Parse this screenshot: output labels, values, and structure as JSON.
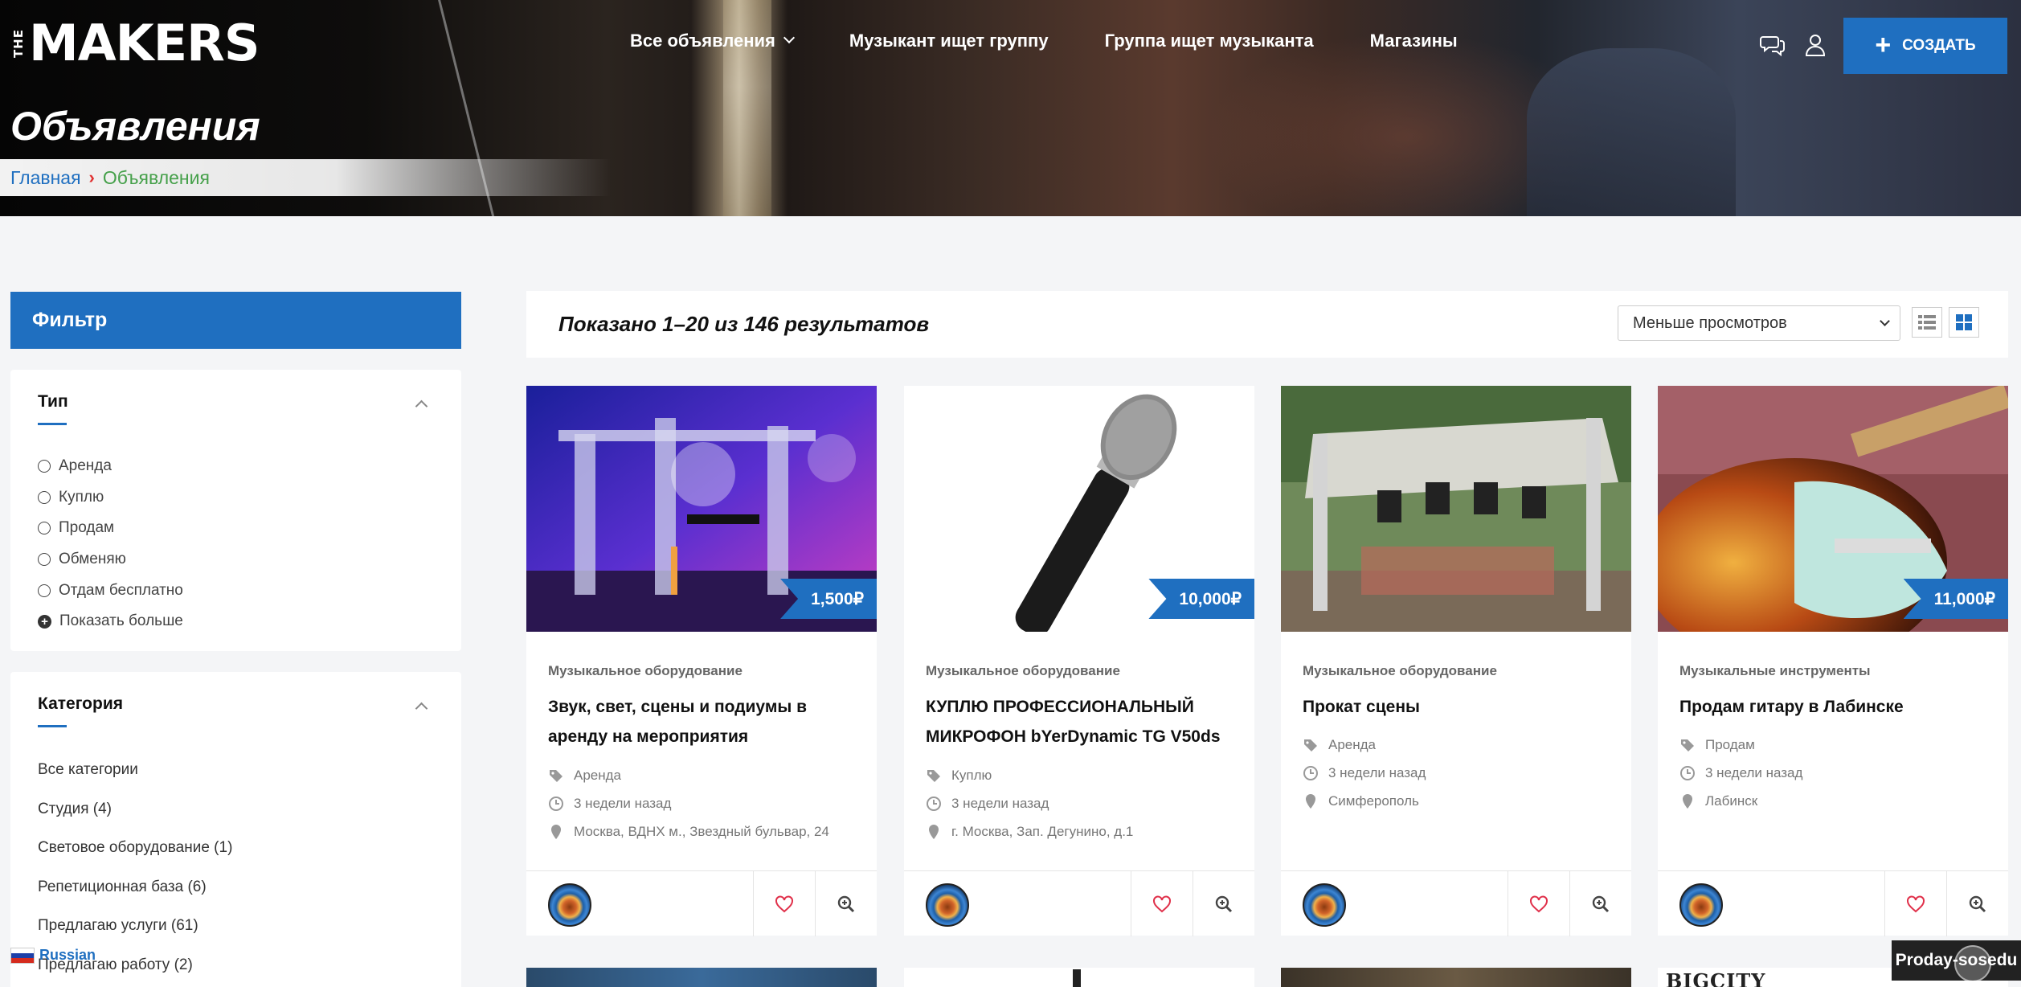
{
  "header": {
    "logo_small": "THE",
    "logo_main": "MAKERS",
    "nav": [
      {
        "label": "Все объявления",
        "has_dropdown": true
      },
      {
        "label": "Музыкант ищет группу"
      },
      {
        "label": "Группа ищет музыканта"
      },
      {
        "label": "Магазины"
      }
    ],
    "icons": [
      "chat-icon",
      "user-icon"
    ],
    "create_label": "СОЗДАТЬ"
  },
  "page": {
    "title": "Объявления",
    "breadcrumb": {
      "home": "Главная",
      "current": "Объявления"
    }
  },
  "sidebar": {
    "filter_title": "Фильтр",
    "type": {
      "title": "Тип",
      "options": [
        "Аренда",
        "Куплю",
        "Продам",
        "Обменяю",
        "Отдам бесплатно"
      ],
      "show_more": "Показать больше"
    },
    "category": {
      "title": "Категория",
      "items": [
        "Все категории",
        "Студия (4)",
        "Световое оборудование (1)",
        "Репетиционная база (6)",
        "Предлагаю услуги (61)",
        "Предлагаю работу (2)"
      ]
    },
    "language": "Russian"
  },
  "results": {
    "count_text": "Показано 1–20 из 146 результатов",
    "sort_selected": "Меньше просмотров",
    "view_modes": [
      "list-view-icon",
      "grid-view-icon"
    ],
    "active_view": "grid"
  },
  "listings": [
    {
      "price": "1,500₽",
      "category": "Музыкальное оборудование",
      "title": "Звук, свет, сцены и подиумы в аренду на мероприятия",
      "type": "Аренда",
      "date": "3 недели назад",
      "location": "Москва, ВДНХ м., Звездный бульвар, 24"
    },
    {
      "price": "10,000₽",
      "category": "Музыкальное оборудование",
      "title": "КУПЛЮ ПРОФЕССИОНАЛЬНЫЙ МИКРОФОН bYerDynamic TG V50ds",
      "type": "Куплю",
      "date": "3 недели назад",
      "location": "г. Москва, Зап. Дегунино, д.1"
    },
    {
      "price": "",
      "category": "Музыкальное оборудование",
      "title": "Прокат сцены",
      "type": "Аренда",
      "date": "3 недели назад",
      "location": "Симферополь"
    },
    {
      "price": "11,000₽",
      "category": "Музыкальные инструменты",
      "title": "Продам гитару в Лабинске",
      "type": "Продам",
      "date": "3 недели назад",
      "location": "Лабинск"
    }
  ],
  "next_row_partial_text": "BIGCITY",
  "footer_badge": "Proday-sosedu",
  "colors": {
    "accent": "#1f6fc0",
    "breadcrumb_current": "#45a04a",
    "breadcrumb_sep": "#e03030",
    "heart": "#e0304a"
  }
}
